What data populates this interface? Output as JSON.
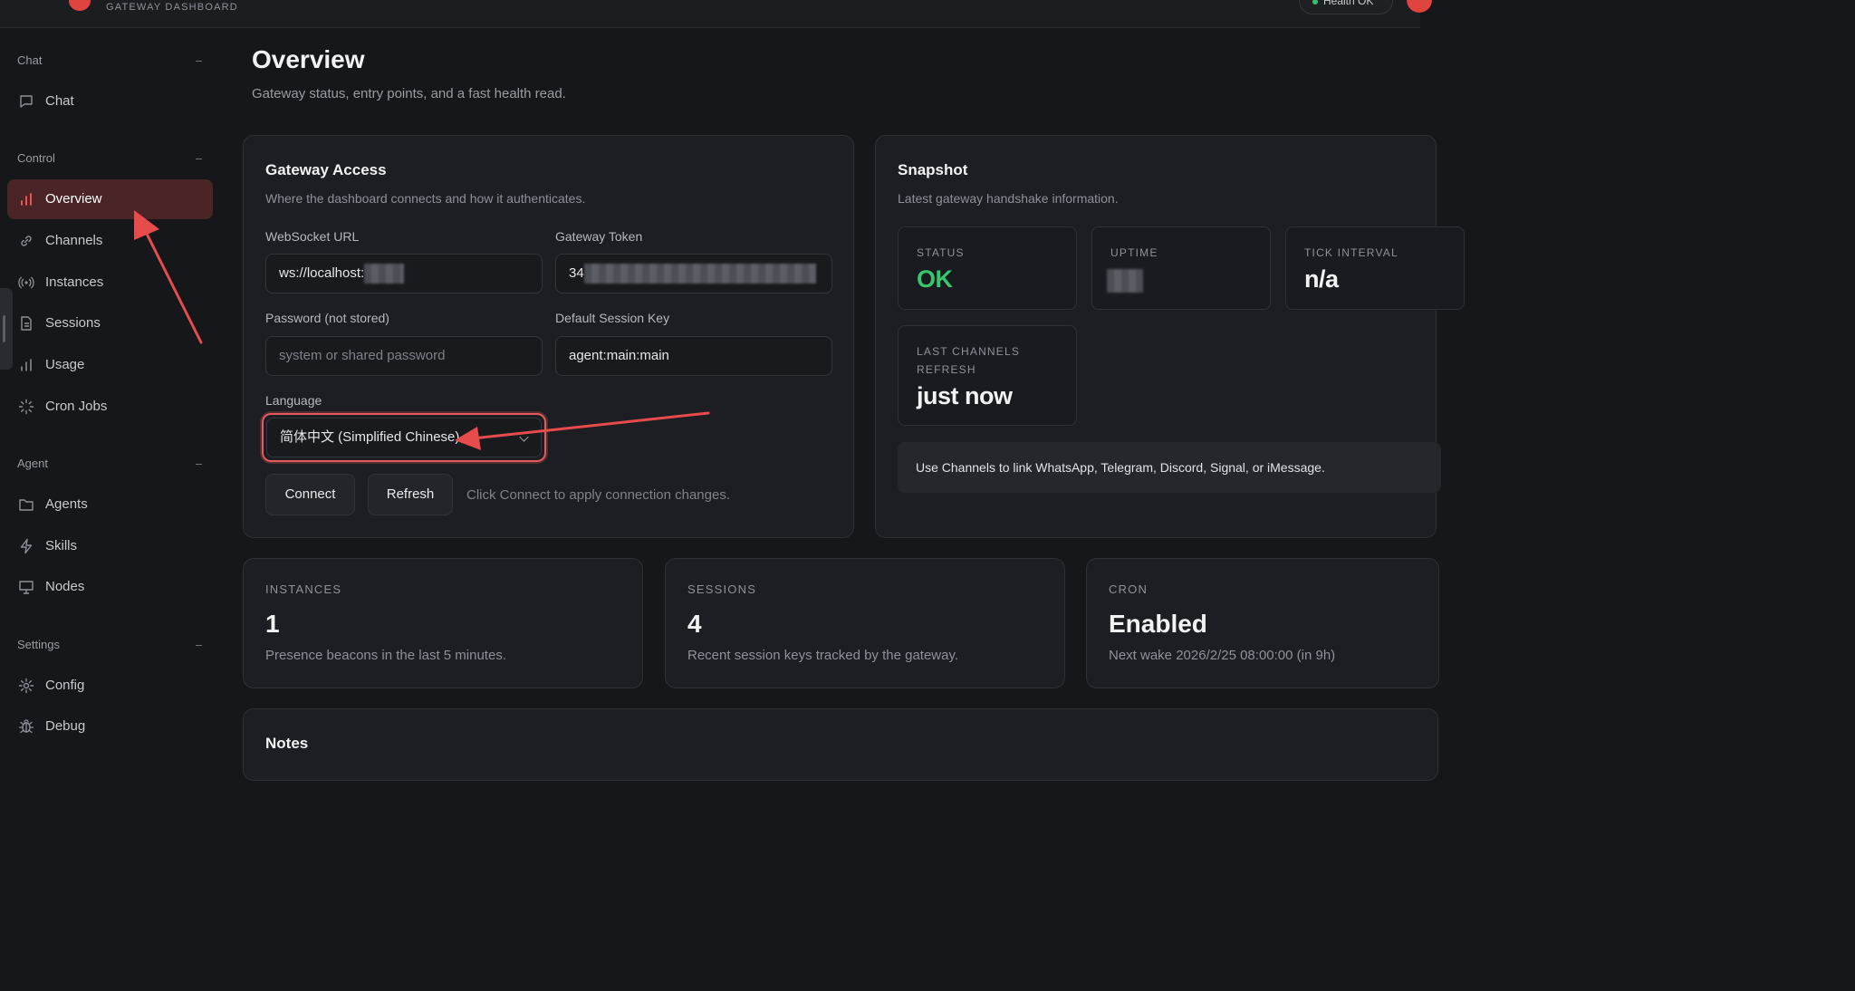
{
  "header": {
    "brand_sub": "GATEWAY DASHBOARD",
    "health": "Health OK"
  },
  "sidebar": {
    "sections": [
      {
        "title": "Chat",
        "items": [
          {
            "label": "Chat",
            "icon": "message-icon"
          }
        ]
      },
      {
        "title": "Control",
        "items": [
          {
            "label": "Overview",
            "icon": "bar-chart-icon",
            "active": true
          },
          {
            "label": "Channels",
            "icon": "link-icon"
          },
          {
            "label": "Instances",
            "icon": "radio-icon"
          },
          {
            "label": "Sessions",
            "icon": "file-icon"
          },
          {
            "label": "Usage",
            "icon": "bar-chart-icon"
          },
          {
            "label": "Cron Jobs",
            "icon": "loader-icon"
          }
        ]
      },
      {
        "title": "Agent",
        "items": [
          {
            "label": "Agents",
            "icon": "folder-icon"
          },
          {
            "label": "Skills",
            "icon": "zap-icon"
          },
          {
            "label": "Nodes",
            "icon": "monitor-icon"
          }
        ]
      },
      {
        "title": "Settings",
        "items": [
          {
            "label": "Config",
            "icon": "gear-icon"
          },
          {
            "label": "Debug",
            "icon": "bug-icon"
          }
        ]
      }
    ]
  },
  "page": {
    "title": "Overview",
    "subtitle": "Gateway status, entry points, and a fast health read."
  },
  "gateway_access": {
    "title": "Gateway Access",
    "subtitle": "Where the dashboard connects and how it authenticates.",
    "ws_label": "WebSocket URL",
    "ws_value": "ws://localhost:",
    "token_label": "Gateway Token",
    "token_value": "34",
    "password_label": "Password (not stored)",
    "password_placeholder": "system or shared password",
    "session_key_label": "Default Session Key",
    "session_key_value": "agent:main:main",
    "language_label": "Language",
    "language_value": "简体中文 (Simplified Chinese)",
    "connect_label": "Connect",
    "refresh_label": "Refresh",
    "hint": "Click Connect to apply connection changes."
  },
  "snapshot": {
    "title": "Snapshot",
    "subtitle": "Latest gateway handshake information.",
    "status_label": "STATUS",
    "status_value": "OK",
    "uptime_label": "UPTIME",
    "tick_label": "TICK INTERVAL",
    "tick_value": "n/a",
    "refresh_label_1": "LAST CHANNELS",
    "refresh_label_2": "REFRESH",
    "refresh_value": "just now",
    "callout": "Use Channels to link WhatsApp, Telegram, Discord, Signal, or iMessage."
  },
  "kpis": [
    {
      "label": "INSTANCES",
      "value": "1",
      "desc": "Presence beacons in the last 5 minutes."
    },
    {
      "label": "SESSIONS",
      "value": "4",
      "desc": "Recent session keys tracked by the gateway."
    },
    {
      "label": "CRON",
      "value": "Enabled",
      "desc": "Next wake 2026/2/25 08:00:00 (in 9h)"
    }
  ],
  "notes": {
    "title": "Notes"
  },
  "colors": {
    "accent": "#e0443e",
    "ok": "#37c66c",
    "annotation": "#e84b4b"
  }
}
